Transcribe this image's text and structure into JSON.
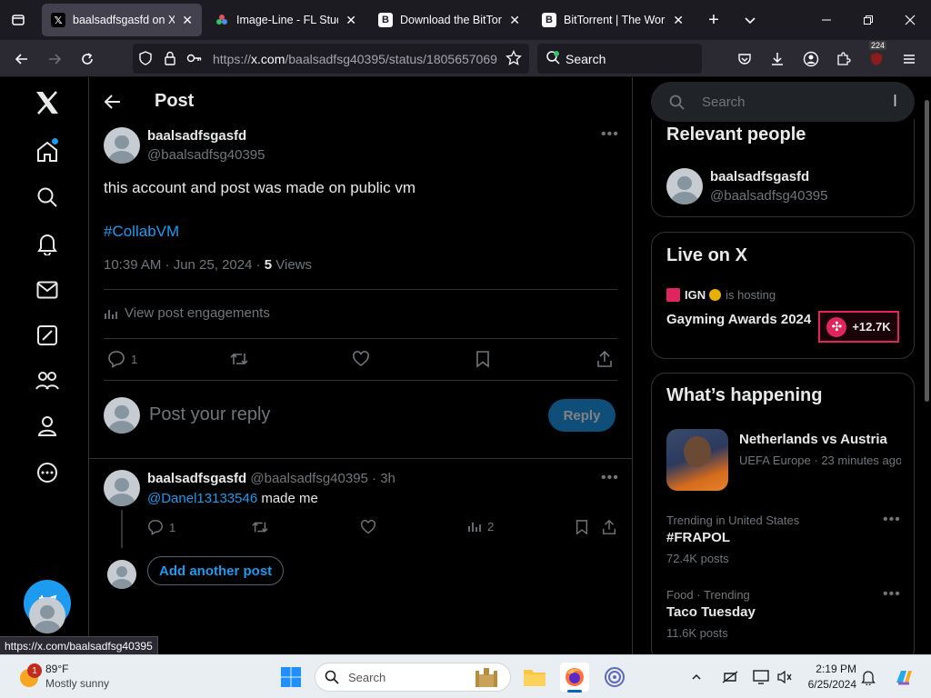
{
  "browser": {
    "tabs": [
      {
        "title": "baalsadfsgasfd on X: \"t",
        "icon": "x-logo-icon",
        "active": true
      },
      {
        "title": "Image-Line - FL Studio",
        "icon": "fl-studio-icon",
        "active": false
      },
      {
        "title": "Download the BitTorrent",
        "icon": "bittorrent-icon",
        "active": false
      },
      {
        "title": "BitTorrent | The World's",
        "icon": "bittorrent-icon",
        "active": false
      }
    ],
    "url_prefix": "https://",
    "url_host": "x.com",
    "url_path": "/baalsadfsg40395/status/1805657069",
    "search_label": "Search",
    "extensions_badge": "224"
  },
  "main": {
    "header_title": "Post",
    "post": {
      "display_name": "baalsadfsgasfd",
      "handle": "@baalsadfsg40395",
      "text": "this account and post was made on public vm",
      "hashtag": "#CollabVM",
      "timestamp": "10:39 AM · Jun 25, 2024 · ",
      "views_count": "5",
      "views_label": " Views",
      "engagements_label": "View post engagements",
      "reply_count": "1"
    },
    "composer": {
      "placeholder": "Post your reply",
      "reply_button": "Reply"
    },
    "reply": {
      "display_name": "baalsadfsgasfd",
      "handle_time": "@baalsadfsg40395 · 3h",
      "mention": "@Danel13133546",
      "text": " made me",
      "reply_count": "1",
      "views_count": "2"
    },
    "add_another_post": "Add another post"
  },
  "right": {
    "search_placeholder": "Search",
    "relevant_people": {
      "title": "Relevant people",
      "name": "baalsadfsgasfd",
      "handle": "@baalsadfsg40395"
    },
    "live": {
      "title": "Live on X",
      "host": "IGN",
      "hosting_label": "is hosting",
      "event": "Gayming Awards 2024",
      "listeners": "+12.7K"
    },
    "happening": {
      "title": "What’s happening",
      "items": [
        {
          "name": "Netherlands vs Austria",
          "meta": "UEFA Europe · 23 minutes ago"
        },
        {
          "meta": "Trending in United States",
          "name": "#FRAPOL",
          "count": "72.4K posts"
        },
        {
          "meta": "Food · Trending",
          "name": "Taco Tuesday",
          "count": "11.6K posts"
        }
      ]
    }
  },
  "status_link": "https://x.com/baalsadfsg40395",
  "taskbar": {
    "weather_temp": "89°F",
    "weather_desc": "Mostly sunny",
    "weather_badge": "1",
    "search_label": "Search",
    "time": "2:19 PM",
    "date": "6/25/2024"
  },
  "colors": {
    "accent": "#1d9bf0",
    "muted": "#71767b",
    "live_red": "#e0245e"
  }
}
